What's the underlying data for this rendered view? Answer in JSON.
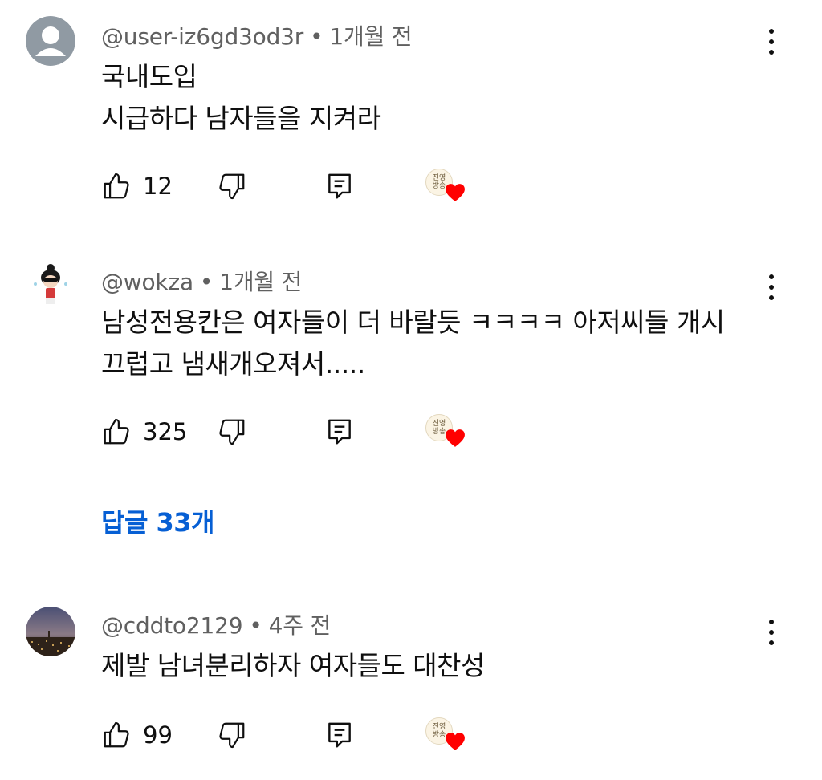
{
  "comments": [
    {
      "author": "@user-iz6gd3od3r",
      "time": "1개월 전",
      "text": "국내도입\n시급하다 남자들을 지켜라",
      "likes": "12",
      "avatar_icon": "default-user-avatar"
    },
    {
      "author": "@wokza",
      "time": "1개월 전",
      "text": "남성전용칸은 여자들이 더 바랄듯 ㅋㅋㅋㅋ 아저씨들 개시\n끄럽고 냄새개오져서.....",
      "likes": "325",
      "avatar_icon": "character-avatar"
    },
    {
      "author": "@cddto2129",
      "time": "4주 전",
      "text": "제발 남녀분리하자 여자들도 대찬성",
      "likes": "99",
      "avatar_icon": "city-night-avatar"
    }
  ],
  "replies_label": "답글 33개",
  "creator_badge_text": "진영\n방송",
  "colors": {
    "link": "#065fd4",
    "meta": "#606060",
    "heart": "#ff0000",
    "text": "#0f0f0f"
  },
  "icons": [
    "thumbs-up-icon",
    "thumbs-down-icon",
    "reply-icon",
    "creator-heart-icon",
    "more-vert-icon"
  ]
}
